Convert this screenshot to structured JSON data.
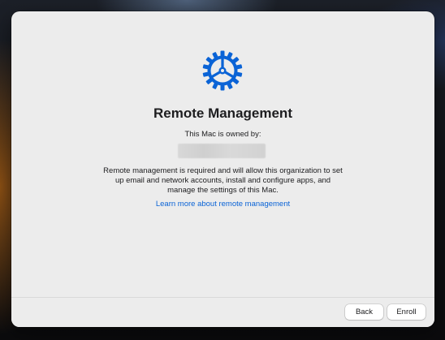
{
  "dialog": {
    "icon": "gear-icon",
    "accent_color": "#0a63d6",
    "title": "Remote Management",
    "owner_label": "This Mac is owned by:",
    "owner_value": "",
    "description": "Remote management is required and will allow this organization to set up email and network accounts, install and configure apps, and manage the settings of this Mac.",
    "learn_more_link": "Learn more about remote management"
  },
  "footer": {
    "back_label": "Back",
    "enroll_label": "Enroll"
  }
}
